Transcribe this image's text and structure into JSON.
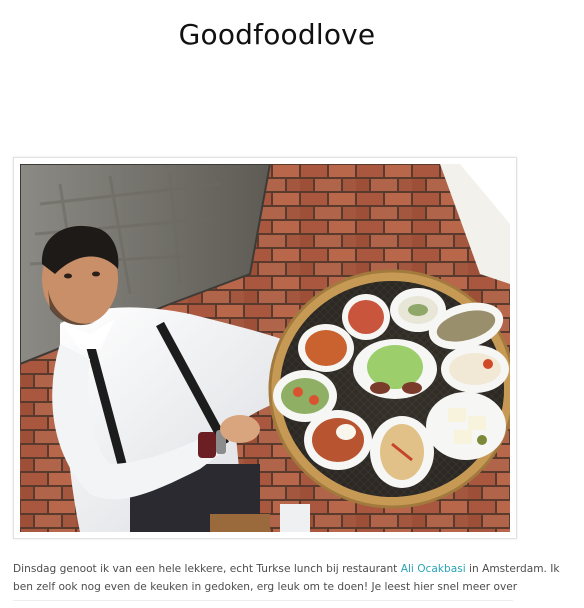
{
  "page": {
    "title": "Goodfoodlove"
  },
  "photo": {
    "alt": "",
    "subject": "photo-restaurant-chef-with-mezze-platter"
  },
  "post": {
    "caption_before": "Dinsdag genoot ik van een hele lekkere, echt Turkse lunch bij restaurant ",
    "restaurant_link": "Ali Ocakbasi",
    "caption_after": " in Amsterdam. Ik ben zelf ook nog even de keuken in gedoken, erg leuk om te doen! Je leest hier snel meer over"
  },
  "colors": {
    "link": "#2aa3b8",
    "text": "#4d4d4d",
    "title": "#111111"
  }
}
